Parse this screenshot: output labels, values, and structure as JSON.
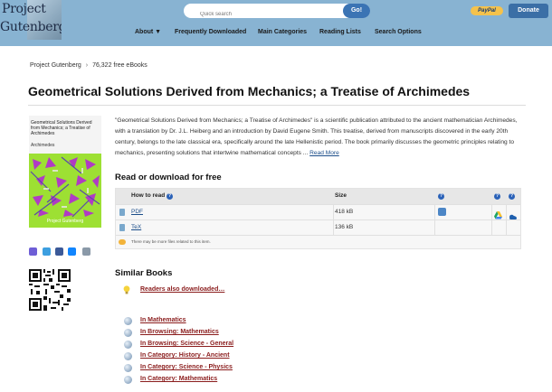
{
  "header": {
    "logo_line1": "Project",
    "logo_line2": "Gutenberg",
    "search_placeholder": "Quick search",
    "go_label": "Go!",
    "paypal_label": "PayPal",
    "donate_label": "Donate",
    "nav": [
      "About ▼",
      "Frequently Downloaded",
      "Main Categories",
      "Reading Lists",
      "Search Options"
    ]
  },
  "breadcrumb": {
    "home": "Project Gutenberg",
    "sep": "›",
    "count": "76,322 free eBooks"
  },
  "book": {
    "title": "Geometrical Solutions Derived from Mechanics; a Treatise of Archimedes",
    "cover_title": "Geometrical Solutions Derived from Mechanics; a Treatise of Archimedes",
    "cover_author": "Archimedes",
    "cover_publisher": "Project Gutenberg",
    "description": "\"Geometrical Solutions Derived from Mechanics; a Treatise of Archimedes\" is a scientific publication attributed to the ancient mathematician Archimedes, with a translation by Dr. J.L. Heiberg and an introduction by David Eugene Smith. This treatise, derived from manuscripts discovered in the early 20th century, belongs to the late classical era, specifically around the late Hellenistic period. The book primarily discusses the geometric principles relating to mechanics, presenting solutions that intertwine mathematical concepts ... ",
    "read_more": "Read More"
  },
  "download": {
    "heading": "Read or download for free",
    "col_how": "How to read",
    "col_size": "Size",
    "help": "?",
    "rows": [
      {
        "format": "PDF",
        "size": "418 kB"
      },
      {
        "format": "TeX",
        "size": "136 kB"
      }
    ],
    "note": "There may be more files related to this item."
  },
  "similar": {
    "heading": "Similar Books",
    "also": "Readers also downloaded…",
    "links": [
      "In Mathematics",
      "In Browsing: Mathematics",
      "In Browsing: Science - General",
      "In Category: History - Ancient",
      "In Category: Science - Physics",
      "In Category: Mathematics"
    ]
  }
}
